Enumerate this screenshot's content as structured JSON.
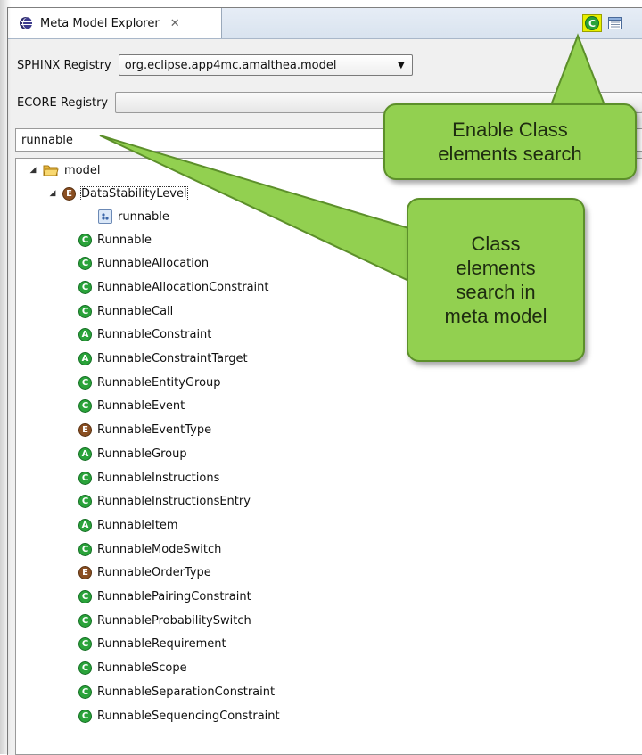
{
  "view": {
    "tab_title": "Meta Model Explorer",
    "tab_close": "✕",
    "tab_icon": "eclipse-icon"
  },
  "toolbar": {
    "enable_class_search_icon": "class-c-icon",
    "view_menu_icon": "view-menu-icon"
  },
  "registry": {
    "sphinx_label": "SPHINX Registry",
    "sphinx_value": "org.eclipse.app4mc.amalthea.model",
    "ecore_label": "ECORE Registry",
    "ecore_value": ""
  },
  "search": {
    "value": "runnable"
  },
  "tree": {
    "root": "model",
    "enum_node": "DataStabilityLevel",
    "enum_literal": "runnable",
    "items": [
      {
        "type": "C",
        "label": "Runnable"
      },
      {
        "type": "C",
        "label": "RunnableAllocation"
      },
      {
        "type": "C",
        "label": "RunnableAllocationConstraint"
      },
      {
        "type": "C",
        "label": "RunnableCall"
      },
      {
        "type": "A",
        "label": "RunnableConstraint"
      },
      {
        "type": "A",
        "label": "RunnableConstraintTarget"
      },
      {
        "type": "C",
        "label": "RunnableEntityGroup"
      },
      {
        "type": "C",
        "label": "RunnableEvent"
      },
      {
        "type": "E",
        "label": "RunnableEventType"
      },
      {
        "type": "A",
        "label": "RunnableGroup"
      },
      {
        "type": "C",
        "label": "RunnableInstructions"
      },
      {
        "type": "C",
        "label": "RunnableInstructionsEntry"
      },
      {
        "type": "A",
        "label": "RunnableItem"
      },
      {
        "type": "C",
        "label": "RunnableModeSwitch"
      },
      {
        "type": "E",
        "label": "RunnableOrderType"
      },
      {
        "type": "C",
        "label": "RunnablePairingConstraint"
      },
      {
        "type": "C",
        "label": "RunnableProbabilitySwitch"
      },
      {
        "type": "C",
        "label": "RunnableRequirement"
      },
      {
        "type": "C",
        "label": "RunnableScope"
      },
      {
        "type": "C",
        "label": "RunnableSeparationConstraint"
      },
      {
        "type": "C",
        "label": "RunnableSequencingConstraint"
      }
    ]
  },
  "callouts": {
    "enable": {
      "line1": "Enable Class",
      "line2": "elements search"
    },
    "search": {
      "line1": "Class",
      "line2": "elements",
      "line3": "search in",
      "line4": "meta model"
    }
  },
  "colors": {
    "callout_fill": "#92d050",
    "class_icon": "#2aa33a",
    "enum_icon": "#8a4f22",
    "highlight": "#e8f000"
  }
}
